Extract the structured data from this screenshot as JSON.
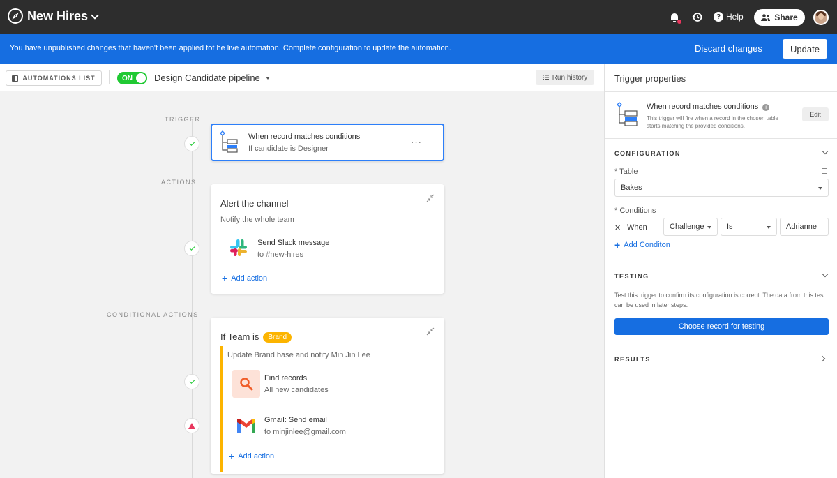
{
  "header": {
    "title": "New Hires",
    "help_label": "Help",
    "share_label": "Share"
  },
  "banner": {
    "message": "You have unpublished changes that haven't been applied tot he live automation. Complete configuration to update the automation.",
    "discard_label": "Discard changes",
    "update_label": "Update"
  },
  "toolbar": {
    "automations_list_label": "AUTOMATIONS LIST",
    "toggle_label": "ON",
    "automation_name": "Design Candidate pipeline",
    "run_history_label": "Run history"
  },
  "canvas": {
    "trigger_label": "TRIGGER",
    "actions_label": "ACTIONS",
    "conditional_actions_label": "CONDITIONAL ACTIONS",
    "trigger": {
      "title": "When record matches conditions",
      "subtitle": "If candidate is Designer",
      "menu": "···"
    },
    "alert_card": {
      "title": "Alert the channel",
      "subtitle": "Notify the whole team",
      "step_title": "Send Slack message",
      "step_subtitle": "to #new-hires",
      "add_action": "Add action"
    },
    "conditional_card": {
      "title_prefix": "If Team is",
      "badge": "Brand",
      "subtitle": "Update Brand base and notify Min Jin Lee",
      "find_title": "Find records",
      "find_subtitle": "All new candidates",
      "gmail_title": "Gmail: Send email",
      "gmail_subtitle": "to minjinlee@gmail.com",
      "add_action": "Add action"
    }
  },
  "panel": {
    "title": "Trigger properties",
    "trigger_title": "When record matches conditions",
    "trigger_desc": "This trigger will fire when a record in the chosen table starts matching the provided conditions.",
    "edit_label": "Edit",
    "configuration_label": "CONFIGURATION",
    "table_label": "* Table",
    "table_value": "Bakes",
    "conditions_label": "* Conditions",
    "condition": {
      "remove": "✕",
      "when": "When",
      "field": "Challenge",
      "operator": "Is",
      "value": "Adrianne"
    },
    "add_condition": "Add Conditon",
    "testing_label": "TESTING",
    "testing_desc": "Test this trigger to confirm its configuration is correct. The data from this test can be used in later steps.",
    "choose_record_label": "Choose record for testing",
    "results_label": "RESULTS"
  },
  "colors": {
    "topbar": "#2d2d2d",
    "banner": "#166ee1",
    "toggle_on": "#20c933",
    "brand_badge": "#fcb400",
    "warning": "#e8365d"
  }
}
